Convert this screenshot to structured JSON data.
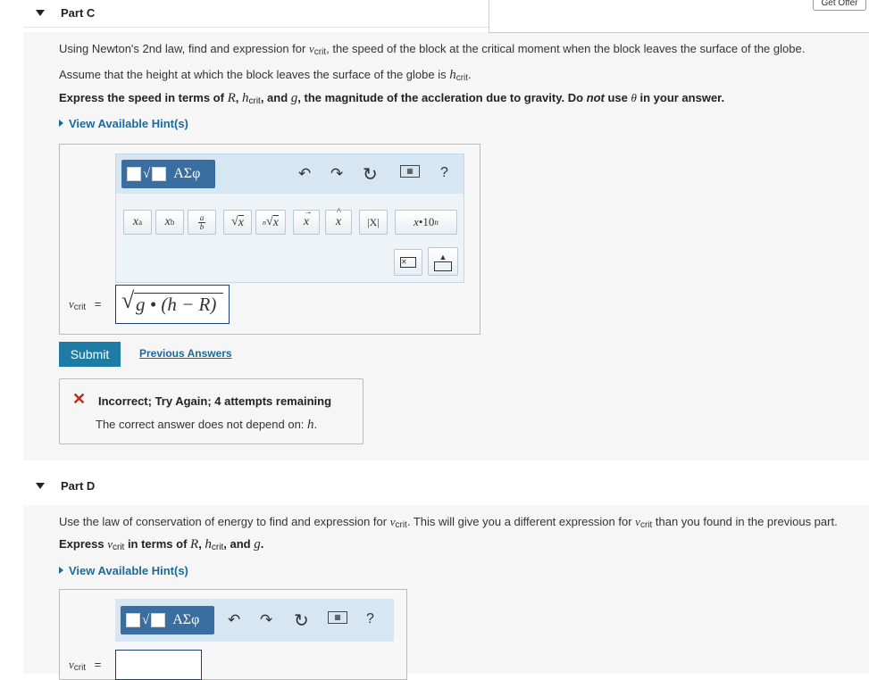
{
  "partC": {
    "title": "Part C",
    "prompt1_a": "Using Newton's 2nd law, find and expression for ",
    "prompt1_var": "v",
    "prompt1_sub": "crit",
    "prompt1_b": ", the speed of the block at the critical moment when the block leaves the surface of the globe.",
    "prompt2_a": "Assume that the height at which the block leaves the surface of the globe is ",
    "prompt2_var": "h",
    "prompt2_sub": "crit",
    "prompt2_b": ".",
    "prompt3_a": "Express the speed in terms of ",
    "prompt3_R": "R",
    "prompt3_h": "h",
    "prompt3_hsub": "crit",
    "prompt3_and": ", and ",
    "prompt3_g": "g",
    "prompt3_b": ", the magnitude of the accleration due to gravity. Do ",
    "prompt3_not": "not",
    "prompt3_use": " use ",
    "prompt3_theta": "θ",
    "prompt3_c": " in your answer.",
    "hint": "View Available Hint(s)",
    "toolbar": {
      "greek": "ΑΣφ",
      "buttons": [
        "xᵃ",
        "x_b",
        "a/b",
        "√x",
        "ⁿ√x",
        "x⃗",
        "x̂",
        "|X|",
        "x·10ⁿ"
      ],
      "help": "?"
    },
    "answer_label_var": "v",
    "answer_label_sub": "crit",
    "answer_eq": "=",
    "answer_value": "g • (h − R)",
    "submit": "Submit",
    "previous": "Previous Answers",
    "feedback_title": "Incorrect; Try Again; 4 attempts remaining",
    "feedback_text": "The correct answer does not depend on: ",
    "feedback_var": "h",
    "feedback_end": "."
  },
  "partD": {
    "title": "Part D",
    "prompt1_a": "Use the law of conservation of energy to find and expression for ",
    "prompt1_var": "v",
    "prompt1_sub": "crit",
    "prompt1_b": ". This will give you a different expression for ",
    "prompt1_c": " than you found in the previous part.",
    "prompt2_a": "Express ",
    "prompt2_b": " in terms of ",
    "prompt2_R": "R",
    "prompt2_h": "h",
    "prompt2_hsub": "crit",
    "prompt2_and": ", and ",
    "prompt2_g": "g",
    "prompt2_end": ".",
    "hint": "View Available Hint(s)",
    "greek": "ΑΣφ",
    "help": "?",
    "answer_label_var": "v",
    "answer_label_sub": "crit",
    "answer_eq": "="
  },
  "offer": {
    "button": "Get Offer"
  }
}
